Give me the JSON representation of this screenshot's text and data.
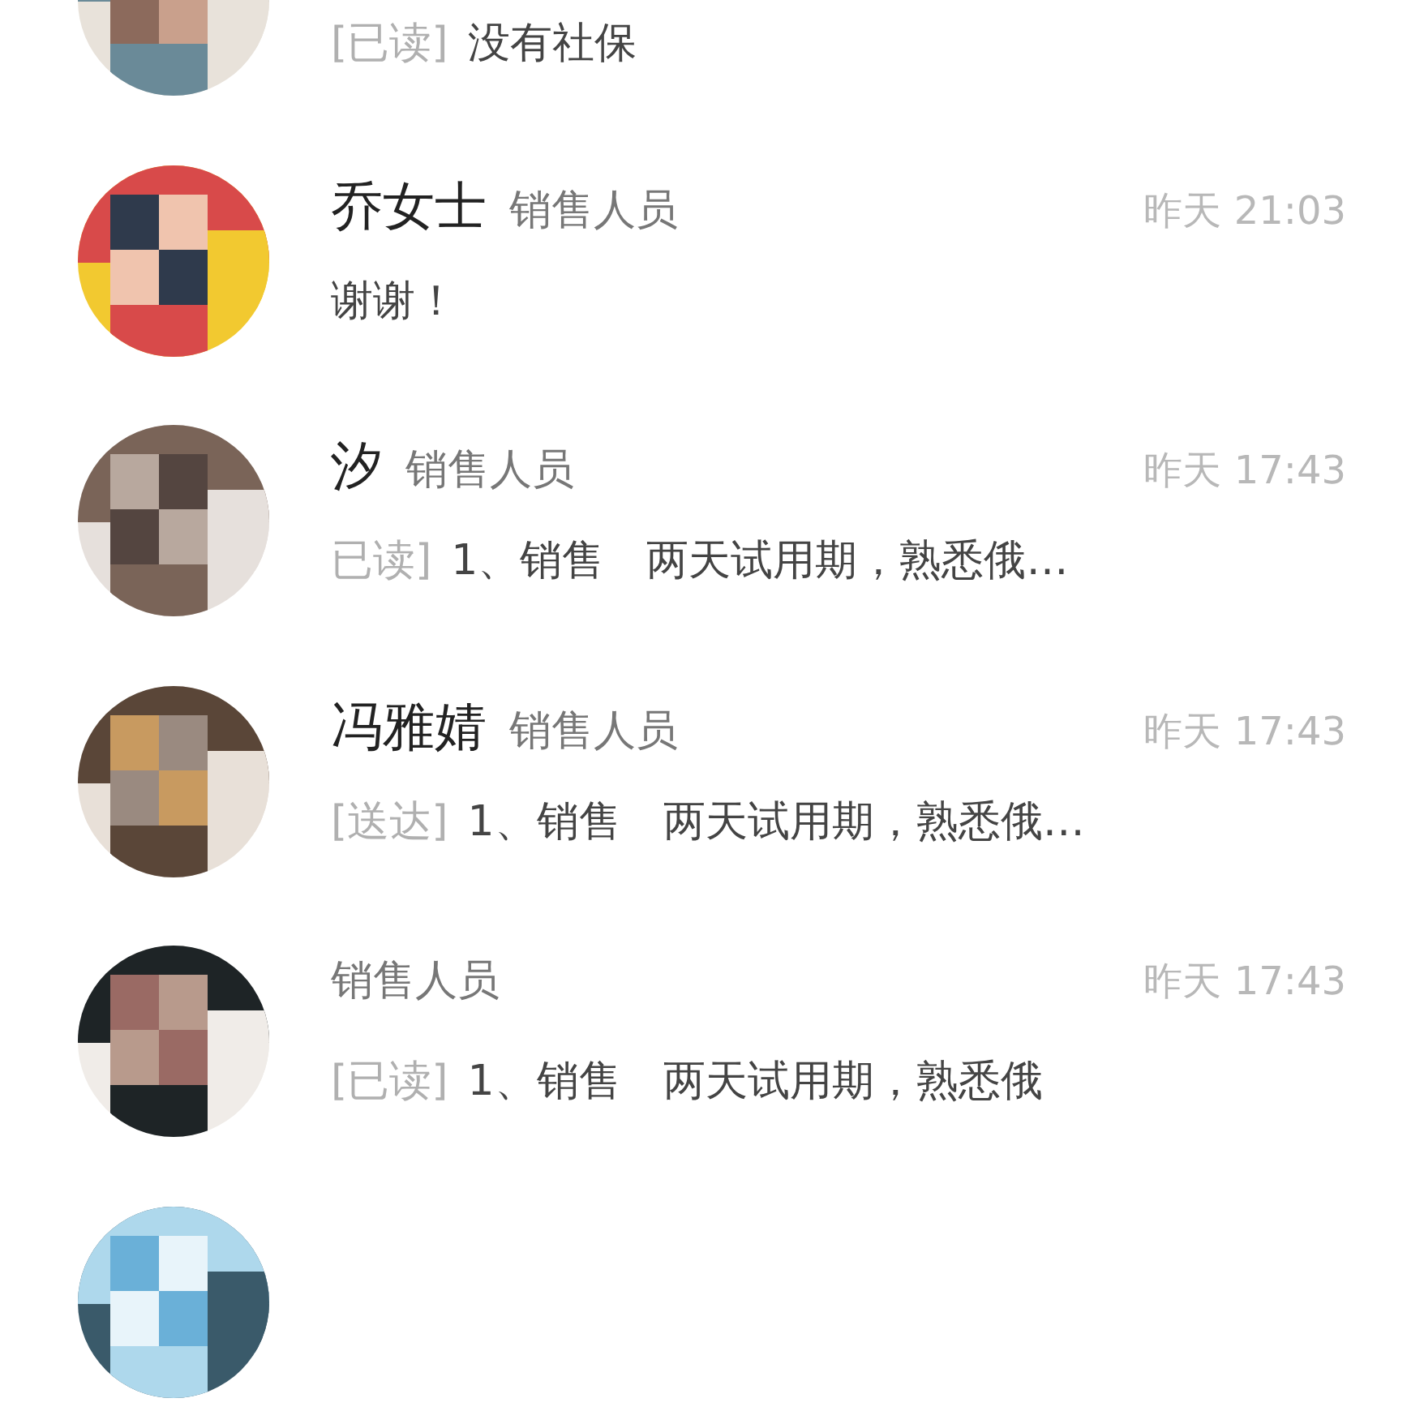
{
  "chats": [
    {
      "avatar": {
        "kind": "picture"
      },
      "status": "[已读]",
      "message": "没有社保"
    },
    {
      "avatar": {
        "kind": "picture"
      },
      "name": "乔女士",
      "role": "销售人员",
      "time": "昨天 21:03",
      "message": "谢谢！"
    },
    {
      "avatar": {
        "kind": "picture"
      },
      "name": "汐",
      "role": "销售人员",
      "time": "昨天 17:43",
      "status": "已读]",
      "message": "1、销售　两天试用期，熟悉俄…"
    },
    {
      "avatar": {
        "kind": "picture"
      },
      "name": "冯雅婧",
      "role": "销售人员",
      "time": "昨天 17:43",
      "status": "[送达]",
      "message": "1、销售　两天试用期，熟悉俄…"
    },
    {
      "avatar": {
        "kind": "picture"
      },
      "role": "销售人员",
      "time": "昨天 17:43",
      "status": "[已读]",
      "message": "1、销售　两天试用期，熟悉俄"
    },
    {
      "avatar": {
        "kind": "picture"
      }
    }
  ]
}
